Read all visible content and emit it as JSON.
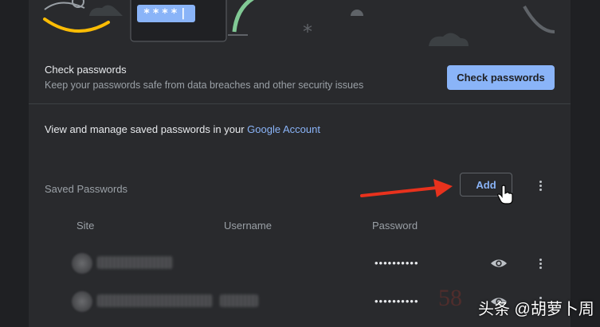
{
  "banner": {
    "password_chip": "****|"
  },
  "check": {
    "title": "Check passwords",
    "description": "Keep your passwords safe from data breaches and other security issues",
    "button_label": "Check passwords"
  },
  "manage": {
    "prefix": "View and manage saved passwords in your ",
    "link": "Google Account"
  },
  "saved": {
    "label": "Saved Passwords",
    "add_label": "Add",
    "columns": {
      "site": "Site",
      "username": "Username",
      "password": "Password"
    },
    "rows": [
      {
        "password": "••••••••••"
      },
      {
        "password": "••••••••••"
      }
    ]
  },
  "colors": {
    "accent": "#8ab4f8",
    "background": "#292a2d",
    "arrow": "#e8321d"
  },
  "watermark": {
    "text": "头条 @胡萝卜周",
    "faint": "58"
  }
}
